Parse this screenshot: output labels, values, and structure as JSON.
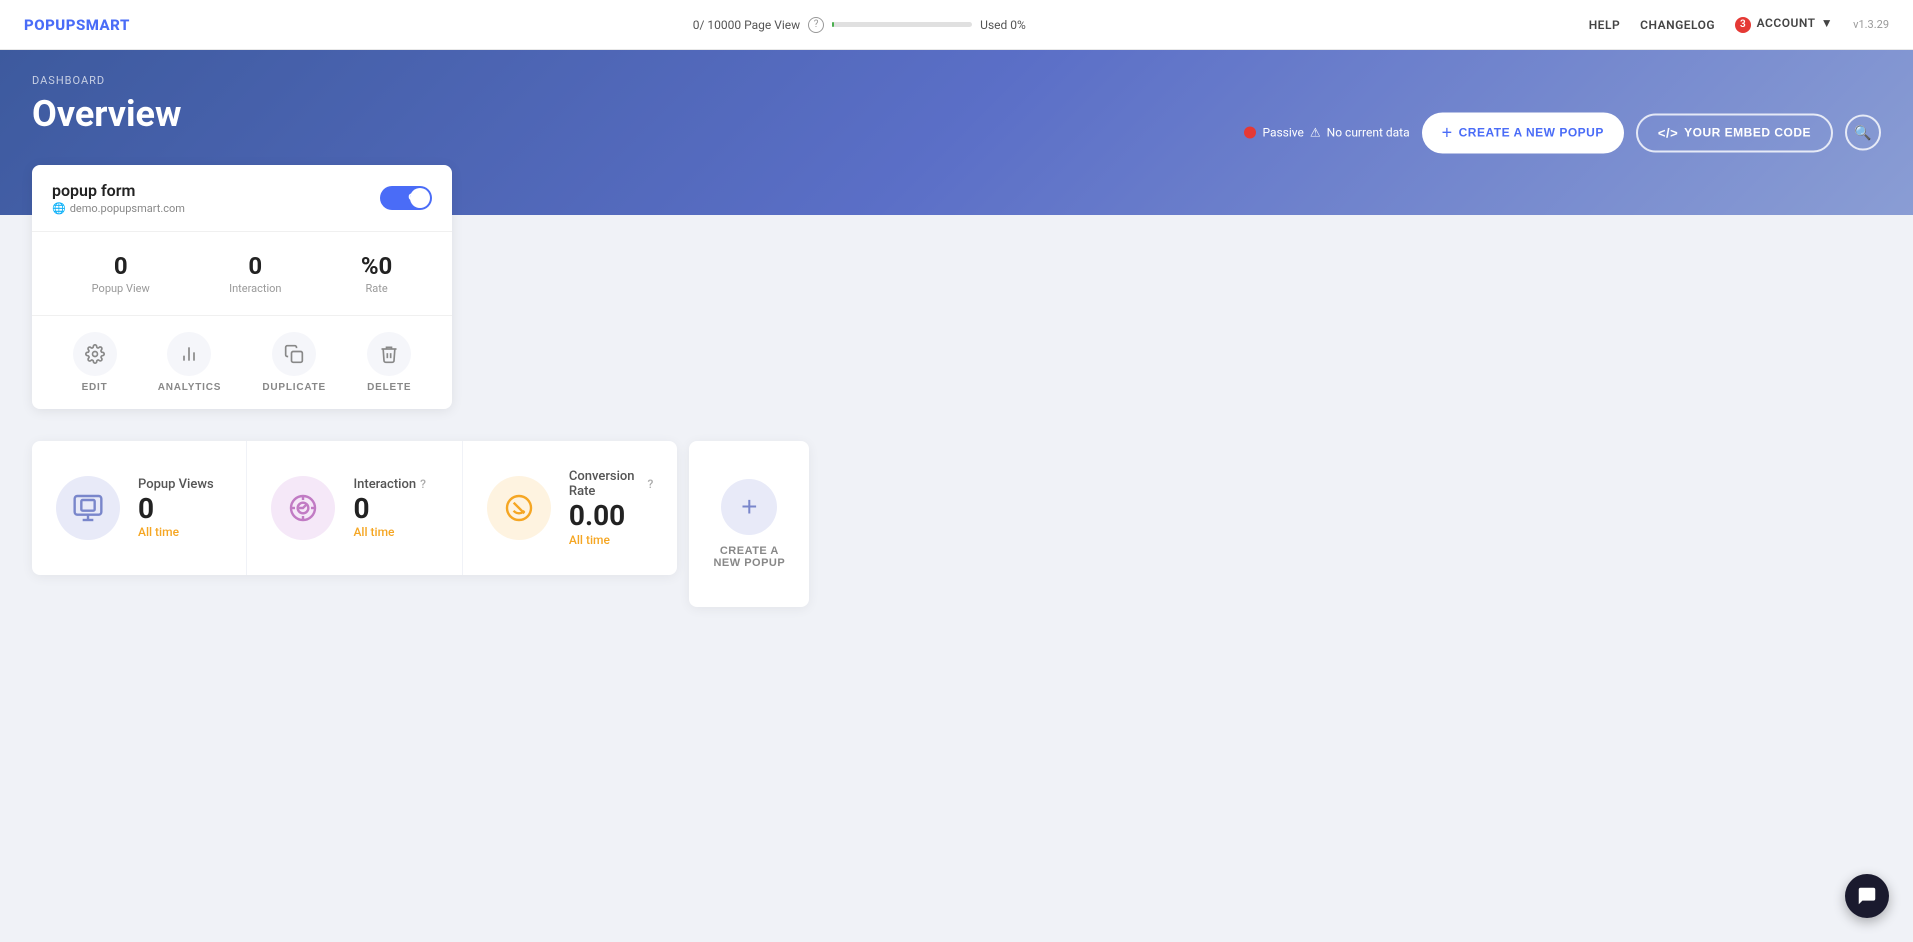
{
  "app": {
    "logo": "POPUPSMART",
    "version": "v1.3.29"
  },
  "topnav": {
    "page_view_label": "0/ 10000 Page View",
    "used_label": "Used 0%",
    "help_label": "?",
    "links": {
      "help": "HELP",
      "changelog": "CHANGELOG",
      "account": "ACCOUNT"
    },
    "account_badge": "3"
  },
  "header": {
    "breadcrumb": "DASHBOARD",
    "title": "Overview",
    "status": {
      "type": "Passive",
      "warning": "⚠",
      "message": "No current data"
    },
    "btn_create": "CREATE A NEW POPUP",
    "btn_embed": "YOUR EMBED CODE"
  },
  "popup_card": {
    "title": "popup form",
    "url": "demo.popupsmart.com",
    "toggle_label": "OFF",
    "stats": [
      {
        "value": "0",
        "label": "Popup View"
      },
      {
        "value": "0",
        "label": "Interaction"
      },
      {
        "value": "%0",
        "label": "Rate"
      }
    ],
    "actions": [
      {
        "id": "edit",
        "label": "EDIT",
        "icon": "⚙"
      },
      {
        "id": "analytics",
        "label": "ANALYTICS",
        "icon": "📊"
      },
      {
        "id": "duplicate",
        "label": "DUPLICATE",
        "icon": "📋"
      },
      {
        "id": "delete",
        "label": "DELETE",
        "icon": "🗑"
      }
    ]
  },
  "stats_summary": [
    {
      "id": "popup-views",
      "label": "Popup Views",
      "value": "0",
      "time": "All time",
      "icon_type": "blue"
    },
    {
      "id": "interaction",
      "label": "Interaction",
      "value": "0",
      "time": "All time",
      "icon_type": "purple"
    },
    {
      "id": "conversion-rate",
      "label": "Conversion Rate",
      "value": "0.00",
      "time": "All time",
      "icon_type": "orange"
    }
  ],
  "create_new": {
    "label": "CREATE A NEW POPUP"
  }
}
